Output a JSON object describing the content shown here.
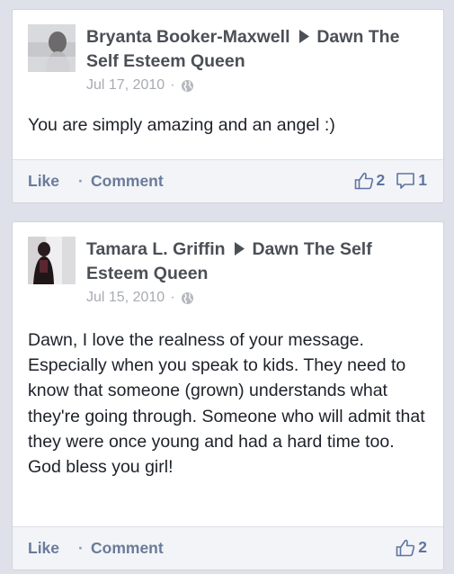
{
  "posts": [
    {
      "author": "Bryanta Booker-Maxwell",
      "target": "Dawn The Self Esteem Queen",
      "date": "Jul 17, 2010",
      "separator": "·",
      "message": "You are simply amazing and an angel :)",
      "actions": {
        "like": "Like",
        "dot": "·",
        "comment": "Comment"
      },
      "like_count": "2",
      "comment_count": "1"
    },
    {
      "author": "Tamara L. Griffin",
      "target": "Dawn The Self Esteem Queen",
      "date": "Jul 15, 2010",
      "separator": "·",
      "message": "Dawn, I love the realness of your message. Especially when you speak to kids. They need to know that someone (grown) understands what they're going through. Someone who will admit that they were once young and had a hard time too. God bless you girl!",
      "actions": {
        "like": "Like",
        "dot": "·",
        "comment": "Comment"
      },
      "like_count": "2"
    }
  ],
  "icons": {
    "arrow": "play-arrow-icon",
    "privacy": "globe-icon",
    "like": "thumbs-up-icon",
    "comment": "comment-bubble-icon"
  },
  "colors": {
    "background": "#dee1e9",
    "link": "#6a7b9b",
    "name": "#4b4f56",
    "meta": "#a8abb2"
  }
}
